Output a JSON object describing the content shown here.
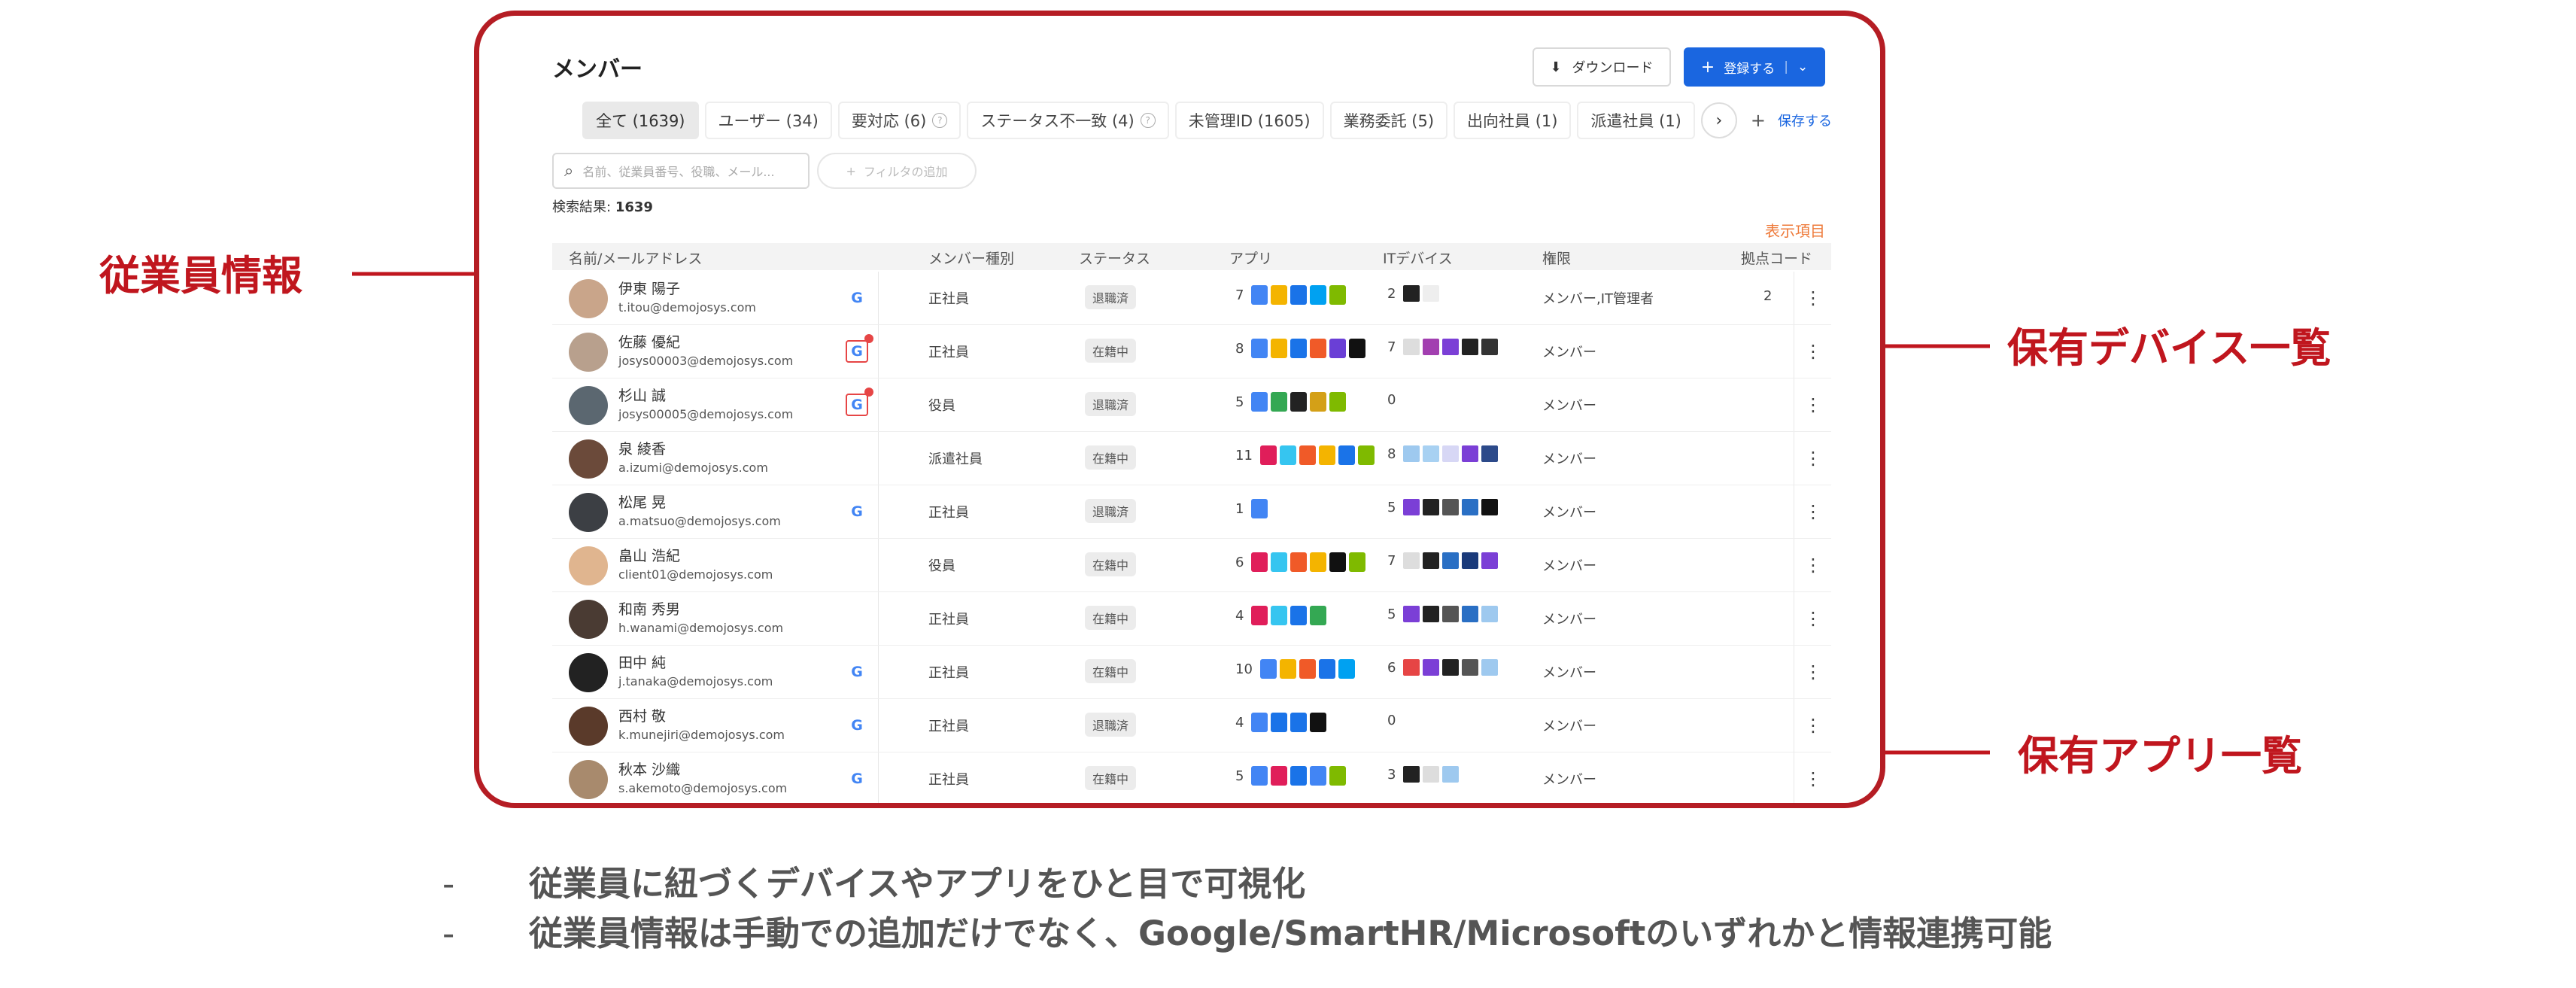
{
  "header": {
    "title": "メンバー",
    "download_label": "ダウンロード",
    "register_label": "登録する"
  },
  "tabs": [
    {
      "label": "全て (1639)",
      "active": true,
      "help": false
    },
    {
      "label": "ユーザー (34)",
      "active": false,
      "help": false
    },
    {
      "label": "要対応 (6)",
      "active": false,
      "help": true
    },
    {
      "label": "ステータス不一致 (4)",
      "active": false,
      "help": true
    },
    {
      "label": "未管理ID (1605)",
      "active": false,
      "help": false
    },
    {
      "label": "業務委託 (5)",
      "active": false,
      "help": false
    },
    {
      "label": "出向社員 (1)",
      "active": false,
      "help": false
    },
    {
      "label": "派遣社員 (1)",
      "active": false,
      "help": false
    }
  ],
  "tab_actions": {
    "next": "›",
    "add": "+",
    "save": "保存する"
  },
  "search": {
    "placeholder": "名前、従業員番号、役職、メール...",
    "filter_label": "フィルタの追加"
  },
  "result": {
    "label": "検索結果:",
    "count": "1639"
  },
  "columns_link": "表示項目",
  "columns": [
    "名前/メールアドレス",
    "メンバー種別",
    "ステータス",
    "アプリ",
    "ITデバイス",
    "権限",
    "拠点コード"
  ],
  "members": [
    {
      "name": "伊東 陽子",
      "email": "t.itou@demojosys.com",
      "source": "G",
      "alert": false,
      "type": "正社員",
      "status": "退職済",
      "apps": "7",
      "app_colors": [
        "#4285f4",
        "#f4b400",
        "#1a73e8",
        "#00a1f1",
        "#7fba00"
      ],
      "devices": "2",
      "device_colors": [
        "#222",
        "#eee"
      ],
      "role": "メンバー,IT管理者",
      "code": "2",
      "avatar": "#c9a58a"
    },
    {
      "name": "佐藤 優紀",
      "email": "josys00003@demojosys.com",
      "source": "G",
      "alert": true,
      "type": "正社員",
      "status": "在籍中",
      "apps": "8",
      "app_colors": [
        "#4285f4",
        "#f4b400",
        "#1a73e8",
        "#f05a28",
        "#6a3fd6",
        "#111"
      ],
      "devices": "7",
      "device_colors": [
        "#ddd",
        "#a23fb0",
        "#7b3fd6",
        "#222",
        "#333"
      ],
      "role": "メンバー",
      "code": "",
      "avatar": "#b8a08d"
    },
    {
      "name": "杉山 誠",
      "email": "josys00005@demojosys.com",
      "source": "G",
      "alert": true,
      "type": "役員",
      "status": "退職済",
      "apps": "5",
      "app_colors": [
        "#4285f4",
        "#34a853",
        "#222",
        "#d4a017",
        "#7fba00"
      ],
      "devices": "0",
      "device_colors": [],
      "role": "メンバー",
      "code": "",
      "avatar": "#5b6770"
    },
    {
      "name": "泉 綾香",
      "email": "a.izumi@demojosys.com",
      "source": "",
      "alert": false,
      "type": "派遣社員",
      "status": "在籍中",
      "apps": "11",
      "app_colors": [
        "#e01e5a",
        "#36c5f0",
        "#f05a28",
        "#f4b400",
        "#1a73e8",
        "#7fba00"
      ],
      "devices": "8",
      "device_colors": [
        "#9ec9ef",
        "#a8d1f2",
        "#d7d7f5",
        "#7b3fd6",
        "#2c4a8a"
      ],
      "role": "メンバー",
      "code": "",
      "avatar": "#6b4a3a"
    },
    {
      "name": "松尾 晃",
      "email": "a.matsuo@demojosys.com",
      "source": "G",
      "alert": false,
      "type": "正社員",
      "status": "退職済",
      "apps": "1",
      "app_colors": [
        "#4285f4"
      ],
      "devices": "5",
      "device_colors": [
        "#7b3fd6",
        "#222",
        "#555",
        "#2a6fc4",
        "#111"
      ],
      "role": "メンバー",
      "code": "",
      "avatar": "#3c3f44"
    },
    {
      "name": "畠山 浩紀",
      "email": "client01@demojosys.com",
      "source": "",
      "alert": false,
      "type": "役員",
      "status": "在籍中",
      "apps": "6",
      "app_colors": [
        "#e01e5a",
        "#36c5f0",
        "#f05a28",
        "#f4b400",
        "#111",
        "#7fba00"
      ],
      "devices": "7",
      "device_colors": [
        "#ddd",
        "#222",
        "#2a6fc4",
        "#1a3a7a",
        "#7b3fd6"
      ],
      "role": "メンバー",
      "code": "",
      "avatar": "#e0b58f"
    },
    {
      "name": "和南 秀男",
      "email": "h.wanami@demojosys.com",
      "source": "",
      "alert": false,
      "type": "正社員",
      "status": "在籍中",
      "apps": "4",
      "app_colors": [
        "#e01e5a",
        "#36c5f0",
        "#1a73e8",
        "#34a853"
      ],
      "devices": "5",
      "device_colors": [
        "#7b3fd6",
        "#222",
        "#555",
        "#2a6fc4",
        "#9ec9ef"
      ],
      "role": "メンバー",
      "code": "",
      "avatar": "#4a3b33"
    },
    {
      "name": "田中 純",
      "email": "j.tanaka@demojosys.com",
      "source": "G",
      "alert": false,
      "type": "正社員",
      "status": "在籍中",
      "apps": "10",
      "app_colors": [
        "#4285f4",
        "#f4b400",
        "#f05a28",
        "#1a73e8",
        "#00a1f1"
      ],
      "devices": "6",
      "device_colors": [
        "#e64545",
        "#7b3fd6",
        "#222",
        "#555",
        "#9ec9ef"
      ],
      "role": "メンバー",
      "code": "",
      "avatar": "#222"
    },
    {
      "name": "西村 敬",
      "email": "k.munejiri@demojosys.com",
      "source": "G",
      "alert": false,
      "type": "正社員",
      "status": "退職済",
      "apps": "4",
      "app_colors": [
        "#4285f4",
        "#1a73e8",
        "#1a73e8",
        "#111"
      ],
      "devices": "0",
      "device_colors": [],
      "role": "メンバー",
      "code": "",
      "avatar": "#5a3a2a"
    },
    {
      "name": "秋本 沙織",
      "email": "s.akemoto@demojosys.com",
      "source": "G",
      "alert": false,
      "type": "正社員",
      "status": "在籍中",
      "apps": "5",
      "app_colors": [
        "#4285f4",
        "#e01e5a",
        "#1a73e8",
        "#4285f4",
        "#7fba00"
      ],
      "devices": "3",
      "device_colors": [
        "#222",
        "#ddd",
        "#9ec9ef"
      ],
      "role": "メンバー",
      "code": "",
      "avatar": "#a88a6d"
    }
  ],
  "callouts": {
    "employee_info": "従業員情報",
    "device_list": "保有デバイス一覧",
    "app_list": "保有アプリ一覧"
  },
  "bullets": [
    {
      "dash": "-",
      "text": "従業員に紐づくデバイスやアプリをひと目で可視化"
    },
    {
      "dash": "-",
      "text": "従業員情報は手動での追加だけでなく、Google/SmartHR/Microsoftのいずれかと情報連携可能"
    }
  ],
  "colors": {
    "accent_red": "#c0161e",
    "primary_blue": "#1a66e0",
    "columns_link": "#ee7a3a"
  }
}
